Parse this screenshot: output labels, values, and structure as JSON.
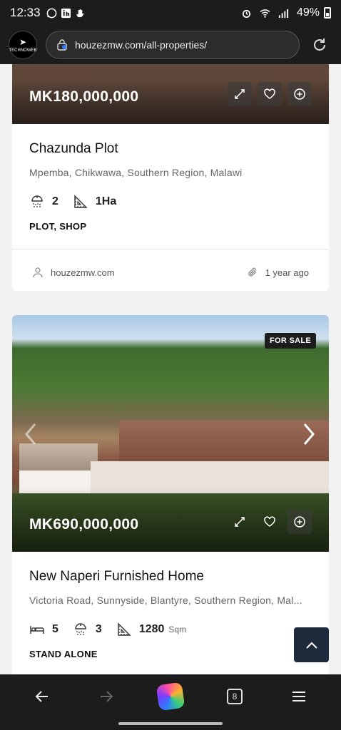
{
  "status_bar": {
    "time": "12:33",
    "battery": "49%",
    "icons": [
      "whatsapp-icon",
      "linkedin-icon",
      "hand-icon",
      "alarm-icon",
      "wifi-icon",
      "signal-icon",
      "battery-icon"
    ]
  },
  "browser": {
    "url": "houzezmw.com/all-properties/",
    "site_logo_text": "TECHNOWEB",
    "tab_count": "8",
    "toolbar_icons": [
      "back-icon",
      "forward-icon",
      "copilot-icon",
      "tabs-icon",
      "menu-icon"
    ]
  },
  "listings": [
    {
      "price": "MK180,000,000",
      "title": "Chazunda Plot",
      "address": "Mpemba, Chikwawa, Southern Region, Malawi",
      "features": [
        {
          "icon": "shower-icon",
          "value": "2",
          "unit": ""
        },
        {
          "icon": "area-icon",
          "value": "1Ha",
          "unit": ""
        }
      ],
      "category": "PLOT, SHOP",
      "author": "houzezmw.com",
      "posted": "1 year ago"
    },
    {
      "price": "MK690,000,000",
      "badge": "FOR SALE",
      "title": "New Naperi Furnished Home",
      "address": "Victoria Road, Sunnyside, Blantyre, Southern Region, Mal...",
      "features": [
        {
          "icon": "bed-icon",
          "value": "5",
          "unit": ""
        },
        {
          "icon": "shower-icon",
          "value": "3",
          "unit": ""
        },
        {
          "icon": "area-icon",
          "value": "1280",
          "unit": "Sqm"
        }
      ],
      "category": "STAND ALONE"
    }
  ],
  "colors": {
    "chrome_dark": "#1c1c1c",
    "back_to_top": "#1e2a3b",
    "page_bg": "#f2f2f2"
  }
}
